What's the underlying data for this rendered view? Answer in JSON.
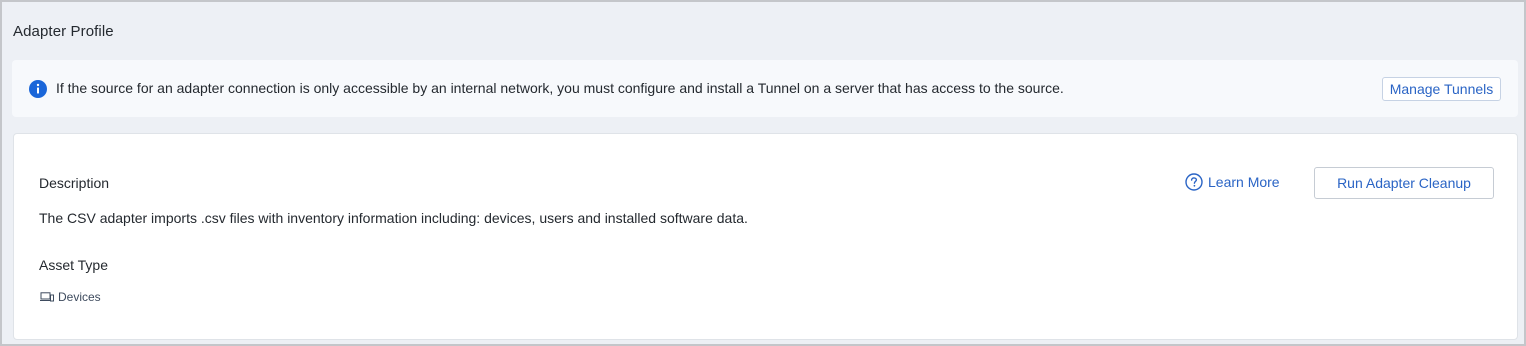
{
  "page": {
    "title": "Adapter Profile"
  },
  "info_banner": {
    "icon": "info-icon",
    "message": "If the source for an adapter connection is only accessible by an internal network, you must configure and install a Tunnel on a server that has access to the source.",
    "button_label": "Manage Tunnels"
  },
  "profile": {
    "description_heading": "Description",
    "description_text": "The CSV adapter imports .csv files with inventory information including: devices, users and installed software data.",
    "asset_type_heading": "Asset Type",
    "asset_types": [
      {
        "icon": "devices-icon",
        "label": "Devices"
      }
    ],
    "learn_more_label": "Learn More",
    "learn_more_icon": "help-circle-icon",
    "cleanup_button_label": "Run Adapter Cleanup"
  },
  "colors": {
    "accent": "#2a64c5",
    "info_icon": "#1a66d9",
    "page_background": "#edf0f5"
  }
}
